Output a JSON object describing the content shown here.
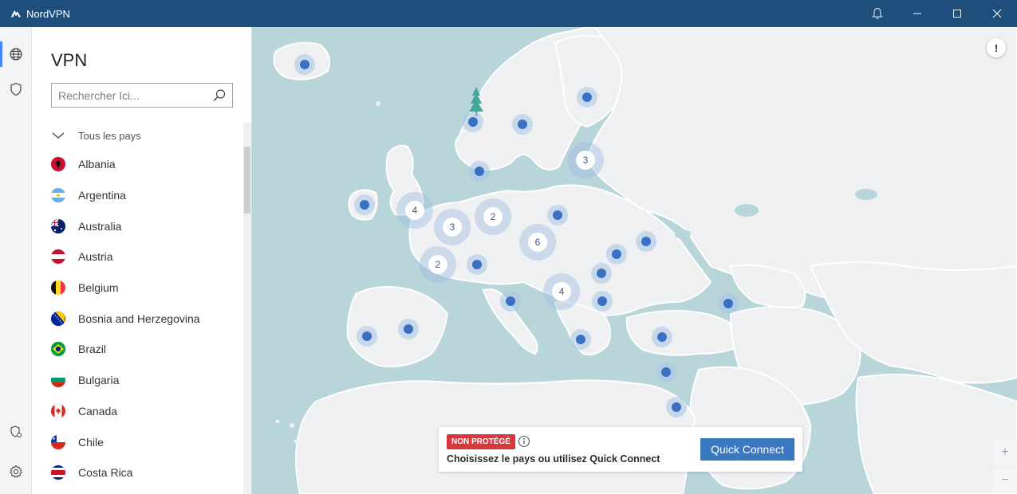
{
  "app": {
    "title": "NordVPN"
  },
  "sidebar": {
    "title": "VPN"
  },
  "search": {
    "placeholder": "Rechercher Ici..."
  },
  "country_group": {
    "label": "Tous les pays"
  },
  "countries": [
    {
      "name": "Albania",
      "flag": "albania-flag"
    },
    {
      "name": "Argentina",
      "flag": "argentina-flag"
    },
    {
      "name": "Australia",
      "flag": "australia-flag"
    },
    {
      "name": "Austria",
      "flag": "austria-flag"
    },
    {
      "name": "Belgium",
      "flag": "belgium-flag"
    },
    {
      "name": "Bosnia and Herzegovina",
      "flag": "bosnia-flag"
    },
    {
      "name": "Brazil",
      "flag": "brazil-flag"
    },
    {
      "name": "Bulgaria",
      "flag": "bulgaria-flag"
    },
    {
      "name": "Canada",
      "flag": "canada-flag"
    },
    {
      "name": "Chile",
      "flag": "chile-flag"
    },
    {
      "name": "Costa Rica",
      "flag": "costa-rica-flag"
    }
  ],
  "map": {
    "alert_icon": "!",
    "clusters": [
      "4",
      "3",
      "2",
      "2",
      "6",
      "4",
      "3"
    ],
    "zoom_in": "+",
    "zoom_out": "−"
  },
  "status": {
    "badge": "NON PROTÉGÉ",
    "hint": "Choisissez le pays ou utilisez Quick Connect",
    "quick_connect": "Quick Connect"
  },
  "colors": {
    "titlebar": "#1e4f7c",
    "accent": "#3a78c2",
    "danger": "#d9373e",
    "water": "#b8d5da",
    "land": "#eef0f2",
    "pin": "#3a70c4"
  }
}
